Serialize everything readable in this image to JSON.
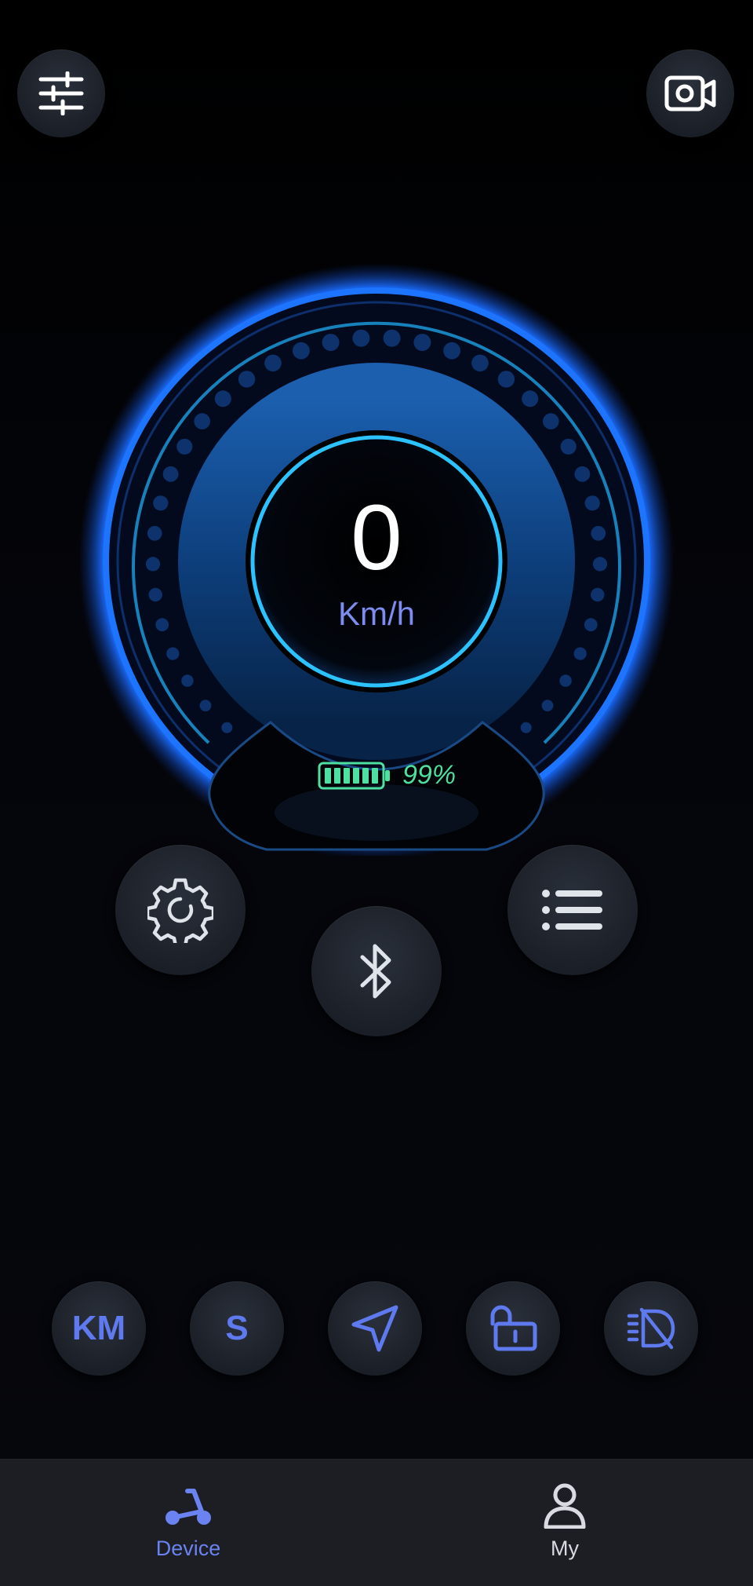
{
  "top_bar": {
    "left_icon": "sliders-icon",
    "right_icon": "camera-icon"
  },
  "speedometer": {
    "speed": "0",
    "unit": "Km/h",
    "battery_percent": "99%",
    "battery_level": 0.99,
    "colors": {
      "ring_glow": "#1a6cff",
      "inner_ring": "#27b8ff",
      "unit_text": "#7d8cef",
      "battery": "#4ee0a0"
    }
  },
  "controls": {
    "settings_icon": "gear-icon",
    "bluetooth_icon": "bluetooth-icon",
    "menu_icon": "list-icon"
  },
  "quick_actions": {
    "km_label": "KM",
    "s_label": "S",
    "navigate_icon": "navigation-arrow-icon",
    "lock_icon": "unlock-icon",
    "light_icon": "headlight-off-icon",
    "accent": "#5f79ef"
  },
  "tabbar": {
    "tabs": [
      {
        "label": "Device",
        "icon": "scooter-icon",
        "active": true
      },
      {
        "label": "My",
        "icon": "person-icon",
        "active": false
      }
    ],
    "active_color": "#6b83f0"
  }
}
